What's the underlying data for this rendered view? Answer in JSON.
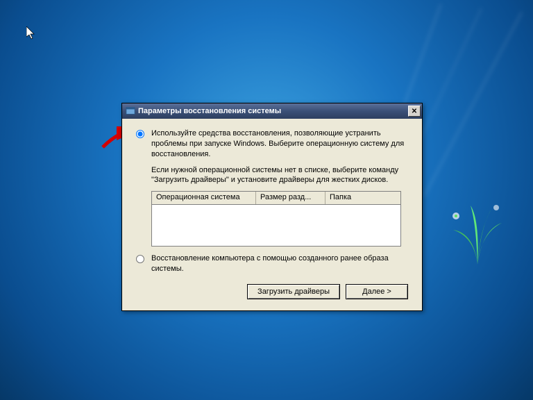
{
  "dialog": {
    "title": "Параметры восстановления системы",
    "close_symbol": "✕",
    "option1": {
      "text": "Используйте средства восстановления, позволяющие устранить проблемы при запуске Windows. Выберите операционную систему для восстановления.",
      "selected": true
    },
    "hint": "Если нужной операционной системы нет в списке, выберите команду \"Загрузить драйверы\" и установите драйверы для жестких дисков.",
    "table": {
      "columns": {
        "os": "Операционная система",
        "size": "Размер разд...",
        "folder": "Папка"
      }
    },
    "option2": {
      "text": "Восстановление компьютера с помощью созданного ранее образа системы.",
      "selected": false
    },
    "buttons": {
      "load_drivers": "Загрузить драйверы",
      "next": "Далее >"
    }
  }
}
